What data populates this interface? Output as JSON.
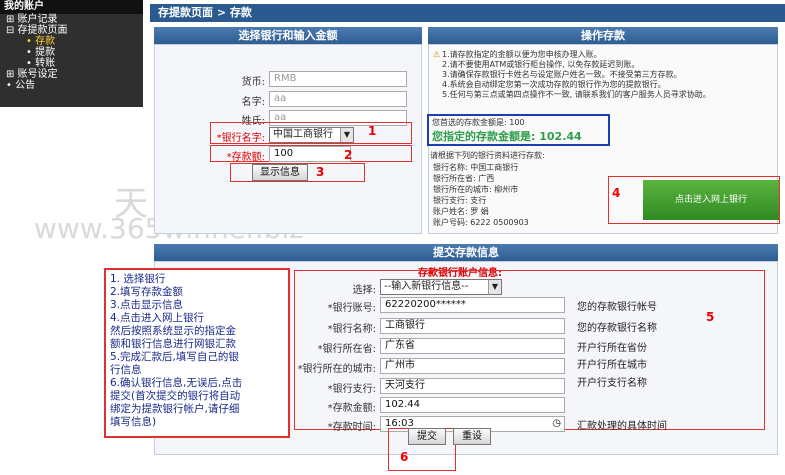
{
  "sidebar": {
    "title": "我的账户",
    "items": [
      {
        "label": "⊞ 账户记录"
      },
      {
        "label": "⊟ 存提款页面"
      },
      {
        "label": "• 存款"
      },
      {
        "label": "• 提款"
      },
      {
        "label": "• 转账"
      },
      {
        "label": "⊞ 账号设定"
      },
      {
        "label": "• 公告"
      }
    ]
  },
  "breadcrumb": "存提款页面 > 存款",
  "left_panel": {
    "title": "选择银行和输入金额",
    "currency_label": "货币:",
    "currency_value": "RMB",
    "name_label": "名字:",
    "name_value": "aa",
    "surname_label": "姓氏:",
    "surname_value": "aa",
    "bank_label": "*银行名字:",
    "bank_value": "中国工商银行",
    "amount_label": "*存款额:",
    "amount_value": "100",
    "show_button": "显示信息"
  },
  "right_panel": {
    "title": "操作存款",
    "notes": [
      "1.请存款指定的金额以便为您申核办理入账。",
      "2.请不要使用ATM或银行柜台操作, 以免存款延迟到账。",
      "3.请确保存款银行卡姓名与设定账户姓名一致。不接受第三方存款。",
      "4.系统会自动绑定您第一次成功存款的银行作为您的提款银行。",
      "5.任何与第三点或第四点操作不一致, 请联系我们的客户服务人员寻求协助。"
    ],
    "selected_amount_label": "您首选的存款金额是: 100",
    "specified_amount": "您指定的存款金额是: 102.44",
    "transfer_intro": "请根据下列的银行资料进行存款:",
    "bank_name": "银行名称: 中国工商银行",
    "bank_province": "银行所在省: 广西",
    "bank_city": "银行所在的城市: 柳州市",
    "bank_branch": "银行支行:          支行",
    "account_name": "账户姓名: 罗  娟",
    "account_no": "账户号码: 6222         0500903",
    "online_bank_button": "点击进入网上银行"
  },
  "submit_panel": {
    "title": "提交存款信息",
    "subtitle": "存款银行账户信息:",
    "select_label": "选择:",
    "select_value": "--输入新银行信息--",
    "account_label": "*银行账号:",
    "account_value": "62220200******",
    "bankname_label": "*银行名称:",
    "bankname_value": "工商银行",
    "province_label": "*银行所在省:",
    "province_value": "广东省",
    "city_label": "*银行所在的城市:",
    "city_value": "广州市",
    "branch_label": "*银行支行:",
    "branch_value": "天河支行",
    "amount_label": "*存款金额:",
    "amount_value": "102.44",
    "time_label": "*存款时间:",
    "time_value": "16:03",
    "submit_button": "提交",
    "reset_button": "重设",
    "hints": [
      "您的存款银行帐号",
      "您的存款银行名称",
      "开户行所在省份",
      "开户行所在城市",
      "开户行支行名称",
      "汇款处理的具体时间"
    ]
  },
  "annotations": {
    "numbers": [
      "1",
      "2",
      "3",
      "4",
      "5",
      "6"
    ],
    "instructions": [
      "1. 选择银行",
      "2.填写存款金额",
      "3.点击显示信息",
      "4.点击进入网上银行",
      "然后按照系统显示的指定金",
      "额和银行信息进行网银汇款",
      "5.完成汇款后,填写自己的银",
      "行信息",
      "6.确认银行信息,无误后,点击",
      "提交(首次提交的银行将自动",
      "绑定为提款银行帐户,请仔细",
      "填写信息)"
    ]
  },
  "watermark": {
    "cn": "天天大赢家",
    "en": "www.365winner.biz"
  },
  "colors": {
    "header_blue": "#2d5d92",
    "annotation_red": "#e03030",
    "online_button_green": "#3f9a2a",
    "highlight_blue": "#1b3fae",
    "amount_green": "#2e9e4a"
  }
}
